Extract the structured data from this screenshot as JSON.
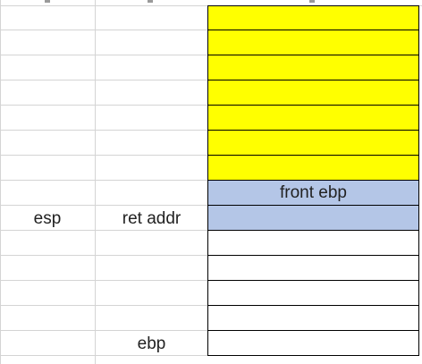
{
  "labels": {
    "esp": "esp",
    "ret_addr": "ret addr",
    "ebp": "ebp",
    "front_ebp": "front ebp"
  },
  "colors": {
    "highlight_yellow": "#ffff00",
    "highlight_blue": "#b4c6e7",
    "gridline": "#d4d4d4",
    "border": "#000000"
  }
}
